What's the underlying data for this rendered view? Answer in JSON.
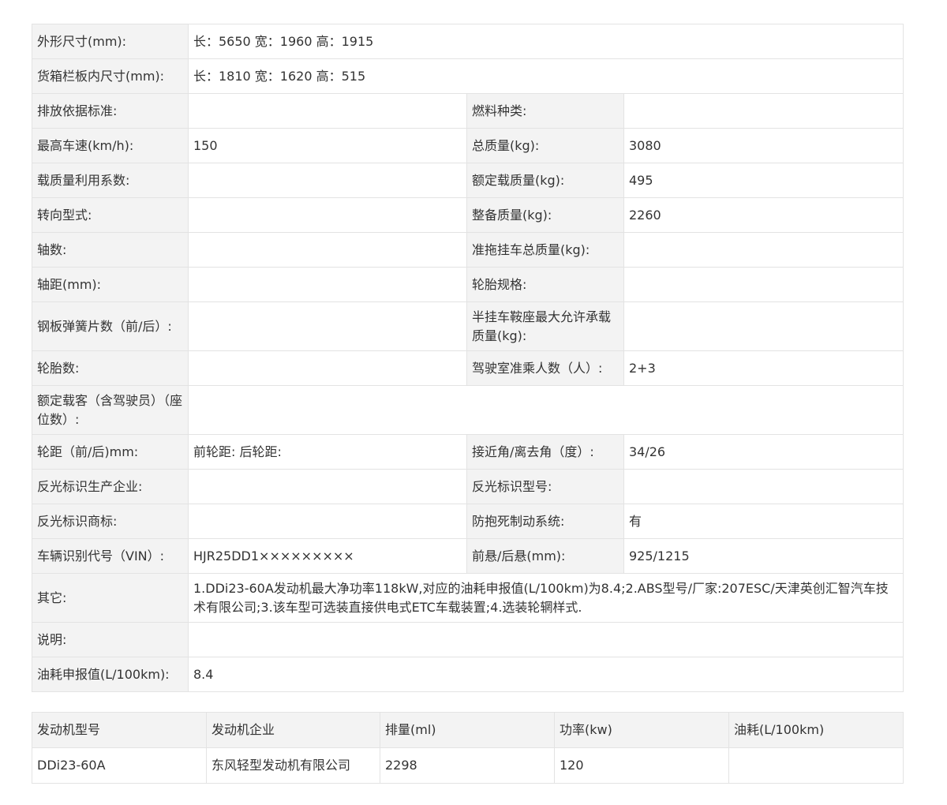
{
  "spec": {
    "dimensions_label": "外形尺寸(mm):",
    "dimensions_value": "长：5650 宽：1960 高：1915",
    "cargo_label": "货箱栏板内尺寸(mm):",
    "cargo_value": "长：1810 宽：1620 高：515",
    "emission_label": "排放依据标准:",
    "emission_value": "",
    "fuel_label": "燃料种类:",
    "fuel_value": "",
    "speed_label": "最高车速(km/h):",
    "speed_value": "150",
    "total_mass_label": "总质量(kg):",
    "total_mass_value": "3080",
    "load_factor_label": "载质量利用系数:",
    "load_factor_value": "",
    "rated_load_label": "额定载质量(kg):",
    "rated_load_value": "495",
    "steering_label": "转向型式:",
    "steering_value": "",
    "curb_mass_label": "整备质量(kg):",
    "curb_mass_value": "2260",
    "axles_label": "轴数:",
    "axles_value": "",
    "trailer_mass_label": "准拖挂车总质量(kg):",
    "trailer_mass_value": "",
    "wheelbase_label": "轴距(mm):",
    "wheelbase_value": "",
    "tire_spec_label": "轮胎规格:",
    "tire_spec_value": "",
    "leaf_spring_label": "钢板弹簧片数（前/后）:",
    "leaf_spring_value": "",
    "saddle_label": "半挂车鞍座最大允许承载质量(kg):",
    "saddle_value": "",
    "tire_count_label": "轮胎数:",
    "tire_count_value": "",
    "cab_passengers_label": "驾驶室准乘人数（人）:",
    "cab_passengers_value": "2+3",
    "rated_passengers_label": "额定载客（含驾驶员）（座位数）:",
    "rated_passengers_value": "",
    "track_label": "轮距（前/后)mm:",
    "track_value": "前轮距: 后轮距:",
    "angle_label": "接近角/离去角（度）:",
    "angle_value": "34/26",
    "reflective_maker_label": "反光标识生产企业:",
    "reflective_maker_value": "",
    "reflective_model_label": "反光标识型号:",
    "reflective_model_value": "",
    "reflective_brand_label": "反光标识商标:",
    "reflective_brand_value": "",
    "abs_label": "防抱死制动系统:",
    "abs_value": "有",
    "vin_label": "车辆识别代号（VIN）:",
    "vin_value": "HJR25DD1×××××××××",
    "overhang_label": "前悬/后悬(mm):",
    "overhang_value": "925/1215",
    "other_label": "其它:",
    "other_value": "1.DDi23-60A发动机最大净功率118kW,对应的油耗申报值(L/100km)为8.4;2.ABS型号/厂家:207ESC/天津英创汇智汽车技术有限公司;3.该车型可选装直接供电式ETC车载装置;4.选装轮辋样式.",
    "note_label": "说明:",
    "note_value": "",
    "fuel_consumption_label": "油耗申报值(L/100km):",
    "fuel_consumption_value": "8.4"
  },
  "engine": {
    "headers": [
      "发动机型号",
      "发动机企业",
      "排量(ml)",
      "功率(kw)",
      "油耗(L/100km)"
    ],
    "row": [
      "DDi23-60A",
      "东风轻型发动机有限公司",
      "2298",
      "120",
      ""
    ]
  }
}
